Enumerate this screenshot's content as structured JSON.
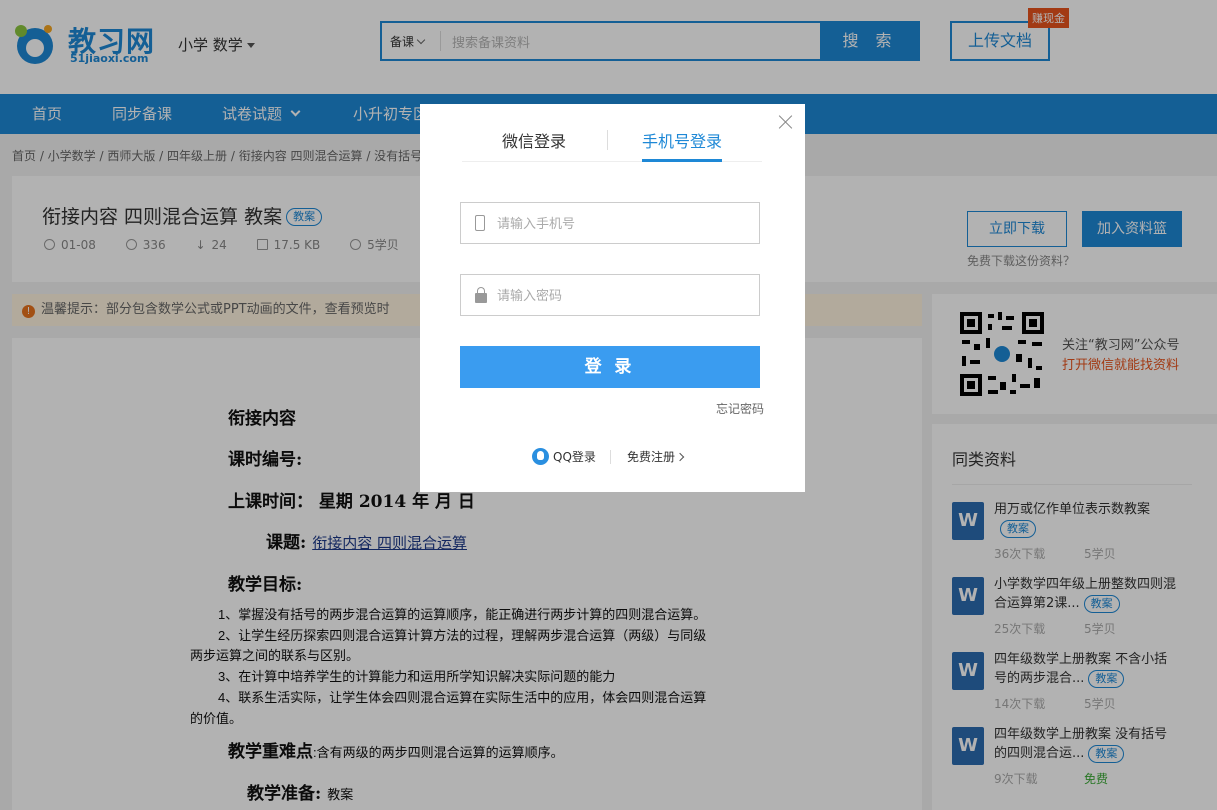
{
  "header": {
    "logo_text": "教习网",
    "logo_sub": "51jiaoxi.com",
    "subject": "小学 数学",
    "search_type": "备课",
    "search_placeholder": "搜索备课资料",
    "search_button": "搜 索",
    "upload_button": "上传文档",
    "earn_badge": "赚现金"
  },
  "nav": {
    "items": [
      {
        "label": "首页"
      },
      {
        "label": "同步备课"
      },
      {
        "label": "试卷试题"
      },
      {
        "label": "小升初专区"
      }
    ]
  },
  "breadcrumb": "首页 / 小学数学 / 西师大版 / 四年级上册 / 衔接内容 四则混合运算 / 没有括号的",
  "document": {
    "title": "衔接内容 四则混合运算 教案",
    "tag": "教案",
    "date": "01-08",
    "views": "336",
    "downloads": "24",
    "size": "17.5 KB",
    "price": "5学贝",
    "download_button": "立即下载",
    "basket_button": "加入资料篮",
    "free_link": "免费下载这份资料？"
  },
  "warning": {
    "icon": "!",
    "text": "温馨提示：部分包含数学公式或PPT动画的文件，查看预览时"
  },
  "preview": {
    "h1": "衔接内容",
    "h2": "课时编号:",
    "h3": "上课时间：  星期     2014 年    月    日",
    "topic_label": "课题:",
    "topic_link": "衔接内容  四则混合运算",
    "goals_title": "教学目标:",
    "goal1": "1、掌握没有括号的两步混合运算的运算顺序，能正确进行两步计算的四则混合运算。",
    "goal2a": "2、让学生经历探索四则混合运算计算方法的过程，理解两步混合运算（两级）与同级",
    "goal2b": "两步运算之间的联系与区别。",
    "goal3": "3、在计算中培养学生的计算能力和运用所学知识解决实际问题的能力",
    "goal4a": "4、联系生活实际，让学生体会四则混合运算在实际生活中的应用，体会四则混合运算",
    "goal4b": "的价值。",
    "key_title": "教学重难点",
    "key_text": ":含有两级的两步四则混合运算的运算顺序。",
    "prep_title": "教学准备:",
    "prep_text": "教案"
  },
  "qr": {
    "line1": "关注“教习网”公众号",
    "line2": "打开微信就能找资料"
  },
  "related": {
    "title": "同类资料",
    "items": [
      {
        "line1": "用万或亿作单位表示数教案",
        "line2": "",
        "tag": "教案",
        "downloads": "36次下载",
        "price": "5学贝"
      },
      {
        "line1": "小学数学四年级上册整数四则混",
        "line2": "合运算第2课...",
        "tag": "教案",
        "downloads": "25次下载",
        "price": "5学贝"
      },
      {
        "line1": "四年级数学上册教案 不含小括",
        "line2": "号的两步混合...",
        "tag": "教案",
        "downloads": "14次下载",
        "price": "5学贝"
      },
      {
        "line1": "四年级数学上册教案 没有括号",
        "line2": "的四则混合运...",
        "tag": "教案",
        "downloads": "9次下载",
        "price": "免费"
      }
    ]
  },
  "modal": {
    "tab_wechat": "微信登录",
    "tab_phone": "手机号登录",
    "phone_placeholder": "请输入手机号",
    "password_placeholder": "请输入密码",
    "login_button": "登 录",
    "forgot": "忘记密码",
    "qq_login": "QQ登录",
    "register": "免费注册"
  },
  "colors": {
    "brand": "#1e88d6",
    "accent": "#e8531d",
    "login_button": "#3a9cf0",
    "free_price": "#3aaa35"
  }
}
